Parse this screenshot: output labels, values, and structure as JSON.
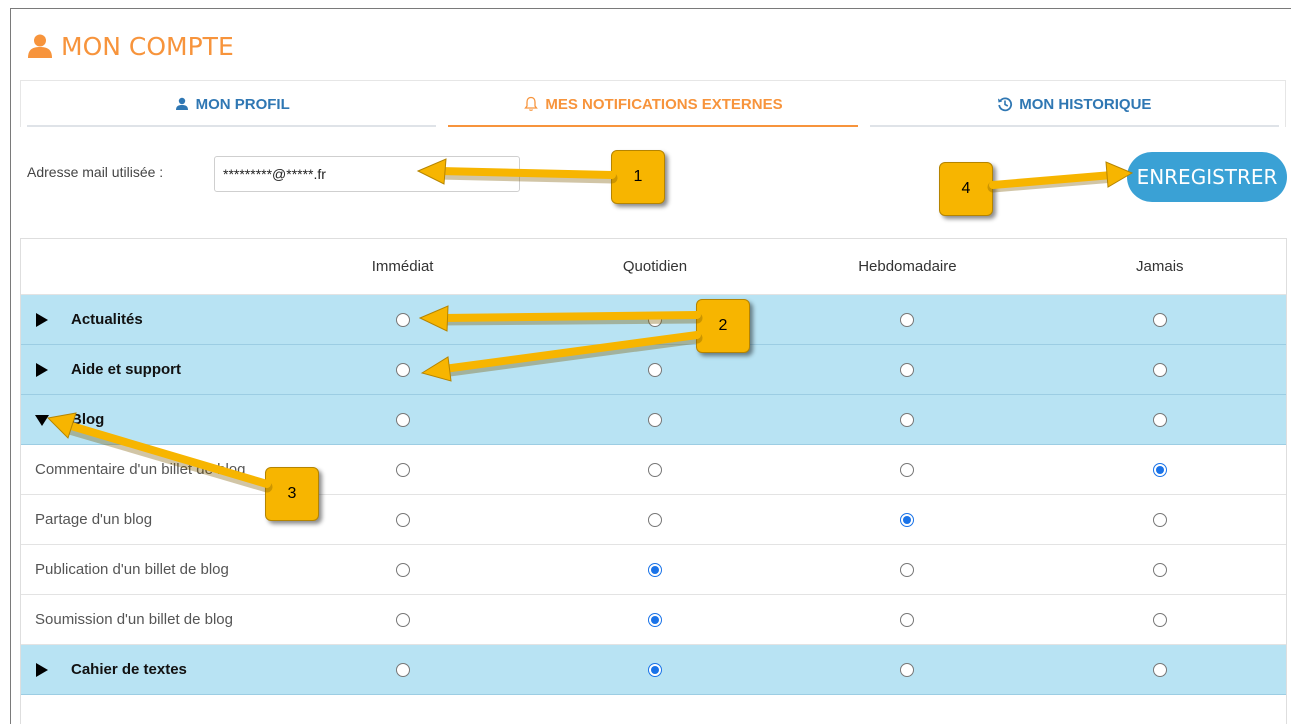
{
  "page": {
    "title": "MON COMPTE"
  },
  "tabs": [
    {
      "label": "MON PROFIL",
      "icon": "user-icon",
      "active": false
    },
    {
      "label": "MES NOTIFICATIONS EXTERNES",
      "icon": "bell-icon",
      "active": true
    },
    {
      "label": "MON HISTORIQUE",
      "icon": "history-icon",
      "active": false
    }
  ],
  "email": {
    "label": "Adresse mail utilisée :",
    "value": "*********@*****.fr"
  },
  "save_button": {
    "label": "ENREGISTRER"
  },
  "table": {
    "columns": [
      "Immédiat",
      "Quotidien",
      "Hebdomadaire",
      "Jamais"
    ],
    "rows": [
      {
        "type": "category",
        "label": "Actualités",
        "expanded": false,
        "selected": null
      },
      {
        "type": "category",
        "label": "Aide et support",
        "expanded": false,
        "selected": null
      },
      {
        "type": "category",
        "label": "Blog",
        "expanded": true,
        "selected": null
      },
      {
        "type": "item",
        "label": "Commentaire d'un billet de blog",
        "selected": 3
      },
      {
        "type": "item",
        "label": "Partage d'un blog",
        "selected": 2
      },
      {
        "type": "item",
        "label": "Publication d'un billet de blog",
        "selected": 1
      },
      {
        "type": "item",
        "label": "Soumission d'un billet de blog",
        "selected": 1
      },
      {
        "type": "category",
        "label": "Cahier de textes",
        "expanded": false,
        "selected": 1
      }
    ]
  },
  "callouts": [
    "1",
    "2",
    "3",
    "4"
  ],
  "colors": {
    "accent": "#f7943c",
    "link": "#2f77b3",
    "button": "#3aa1d5",
    "category_bg": "#b8e3f3",
    "callout": "#f7b500",
    "radio_checked": "#1a73e8"
  }
}
